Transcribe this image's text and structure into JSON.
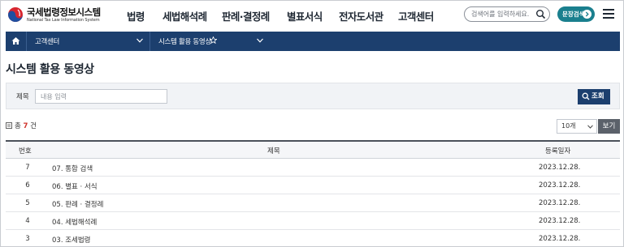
{
  "header": {
    "logo_title": "국세법령정보시스템",
    "logo_subtitle": "National Tax Law Information System",
    "nav": [
      "법령",
      "세법해석례",
      "판례·결정례",
      "별표서식",
      "전자도서관",
      "고객센터"
    ],
    "search_placeholder": "검색어를 입력하세요.",
    "doc_search_label": "문장검색"
  },
  "breadcrumb": {
    "home_icon": "home-icon",
    "level1": "고객센터",
    "level2": "시스템 활용 동영상"
  },
  "page": {
    "title": "시스템 활용 동영상"
  },
  "filter": {
    "label": "제목",
    "input_placeholder": "내용 입력",
    "search_button": "조회"
  },
  "list": {
    "count_prefix": "총",
    "count": "7",
    "count_suffix": "건",
    "per_page": "10개",
    "view_button": "보기",
    "columns": [
      "번호",
      "제목",
      "등록일자"
    ],
    "rows": [
      {
        "no": "7",
        "title": "07. 통합 검색",
        "date": "2023.12.28."
      },
      {
        "no": "6",
        "title": "06. 별표 · 서식",
        "date": "2023.12.28."
      },
      {
        "no": "5",
        "title": "05. 판례 · 결정례",
        "date": "2023.12.28."
      },
      {
        "no": "4",
        "title": "04. 세법해석례",
        "date": "2023.12.28."
      },
      {
        "no": "3",
        "title": "03. 조세법령",
        "date": "2023.12.28."
      }
    ]
  },
  "colors": {
    "navy": "#1c3f6e",
    "teal": "#1a7f8e",
    "count_red": "#d0342c"
  }
}
